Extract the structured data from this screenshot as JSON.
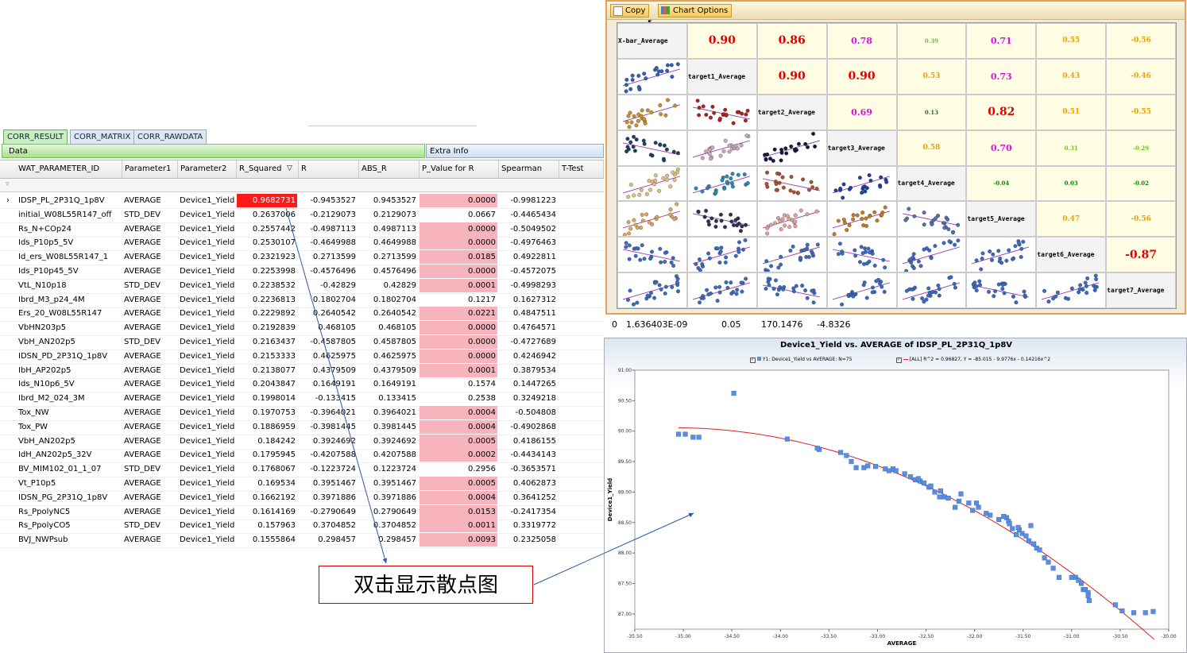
{
  "tabs": [
    "CORR_RESULT",
    "CORR_MATRIX",
    "CORR_RAWDATA"
  ],
  "data_bar": "Data",
  "extra_bar": "Extra Info",
  "columns": [
    "WAT_PARAMETER_ID",
    "Parameter1",
    "Parameter2",
    "R_Squared",
    "R",
    "ABS_R",
    "P_Value for R",
    "Spearman",
    "T-Test"
  ],
  "rows": [
    [
      "IDSP_PL_2P31Q_1p8V",
      "AVERAGE",
      "Device1_Yield",
      "0.9682731",
      "-0.9453527",
      "0.9453527",
      "0.0000",
      "-0.9981223"
    ],
    [
      "initial_W08L55R147_off",
      "STD_DEV",
      "Device1_Yield",
      "0.2637006",
      "-0.2129073",
      "0.2129073",
      "0.0667",
      "-0.4465434"
    ],
    [
      "Rs_N+COp24",
      "AVERAGE",
      "Device1_Yield",
      "0.2557442",
      "-0.4987113",
      "0.4987113",
      "0.0000",
      "-0.5049502"
    ],
    [
      "Ids_P10p5_5V",
      "AVERAGE",
      "Device1_Yield",
      "0.2530107",
      "-0.4649988",
      "0.4649988",
      "0.0000",
      "-0.4976463"
    ],
    [
      "Id_ers_W08L55R147_1",
      "AVERAGE",
      "Device1_Yield",
      "0.2321923",
      "0.2713599",
      "0.2713599",
      "0.0185",
      "0.4922811"
    ],
    [
      "Ids_P10p45_5V",
      "AVERAGE",
      "Device1_Yield",
      "0.2253998",
      "-0.4576496",
      "0.4576496",
      "0.0000",
      "-0.4572075"
    ],
    [
      "VtL_N10p18",
      "STD_DEV",
      "Device1_Yield",
      "0.2238532",
      "-0.42829",
      "0.42829",
      "0.0001",
      "-0.4998293"
    ],
    [
      "Ibrd_M3_p24_4M",
      "AVERAGE",
      "Device1_Yield",
      "0.2236813",
      "0.1802704",
      "0.1802704",
      "0.1217",
      "0.1627312"
    ],
    [
      "Ers_20_W08L55R147",
      "AVERAGE",
      "Device1_Yield",
      "0.2229892",
      "0.2640542",
      "0.2640542",
      "0.0221",
      "0.4847511"
    ],
    [
      "VbHN203p5",
      "AVERAGE",
      "Device1_Yield",
      "0.2192839",
      "0.468105",
      "0.468105",
      "0.0000",
      "0.4764571"
    ],
    [
      "VbH_AN202p5",
      "STD_DEV",
      "Device1_Yield",
      "0.2163437",
      "-0.4587805",
      "0.4587805",
      "0.0000",
      "-0.4727689"
    ],
    [
      "IDSN_PD_2P31Q_1p8V",
      "AVERAGE",
      "Device1_Yield",
      "0.2153333",
      "0.4625975",
      "0.4625975",
      "0.0000",
      "0.4246942"
    ],
    [
      "IbH_AP202p5",
      "AVERAGE",
      "Device1_Yield",
      "0.2138077",
      "0.4379509",
      "0.4379509",
      "0.0001",
      "0.3879534"
    ],
    [
      "Ids_N10p6_5V",
      "AVERAGE",
      "Device1_Yield",
      "0.2043847",
      "0.1649191",
      "0.1649191",
      "0.1574",
      "0.1447265"
    ],
    [
      "Ibrd_M2_024_3M",
      "AVERAGE",
      "Device1_Yield",
      "0.1998014",
      "-0.133415",
      "0.133415",
      "0.2538",
      "0.3249218"
    ],
    [
      "Tox_NW",
      "AVERAGE",
      "Device1_Yield",
      "0.1970753",
      "-0.3964021",
      "0.3964021",
      "0.0004",
      "-0.504808"
    ],
    [
      "Tox_PW",
      "AVERAGE",
      "Device1_Yield",
      "0.1886959",
      "-0.3981445",
      "0.3981445",
      "0.0004",
      "-0.4902868"
    ],
    [
      "VbH_AN202p5",
      "AVERAGE",
      "Device1_Yield",
      "0.184242",
      "0.3924692",
      "0.3924692",
      "0.0005",
      "0.4186155"
    ],
    [
      "IdH_AN202p5_32V",
      "AVERAGE",
      "Device1_Yield",
      "0.1795945",
      "-0.4207588",
      "0.4207588",
      "0.0002",
      "-0.4434143"
    ],
    [
      "BV_MIM102_01_1_07",
      "STD_DEV",
      "Device1_Yield",
      "0.1768067",
      "-0.1223724",
      "0.1223724",
      "0.2956",
      "-0.3653571"
    ],
    [
      "Vt_P10p5",
      "AVERAGE",
      "Device1_Yield",
      "0.169534",
      "0.3951467",
      "0.3951467",
      "0.0005",
      "0.4062873"
    ],
    [
      "IDSN_PG_2P31Q_1p8V",
      "AVERAGE",
      "Device1_Yield",
      "0.1662192",
      "0.3971886",
      "0.3971886",
      "0.0004",
      "0.3641252"
    ],
    [
      "Rs_PpolyNC5",
      "AVERAGE",
      "Device1_Yield",
      "0.1614169",
      "-0.2790649",
      "0.2790649",
      "0.0153",
      "-0.2417354"
    ],
    [
      "Rs_PpolyCO5",
      "STD_DEV",
      "Device1_Yield",
      "0.157963",
      "0.3704852",
      "0.3704852",
      "0.0011",
      "0.3319772"
    ],
    [
      "BVJ_NWPsub",
      "AVERAGE",
      "Device1_Yield",
      "0.1555864",
      "0.298457",
      "0.298457",
      "0.0093",
      "0.2325058"
    ]
  ],
  "colors": {
    "significant": "#f7b4bd",
    "best": "#ff1a1a"
  },
  "matrix": {
    "toolbar": [
      "Copy",
      "Chart Options"
    ],
    "labels": [
      "X-bar_Average",
      "target1_Average",
      "target2_Average",
      "target3_Average",
      "target4_Average",
      "target5_Average",
      "target6_Average",
      "target7_Average"
    ],
    "values": [
      [
        "",
        "0.90",
        "0.86",
        "0.78",
        "0.39",
        "0.71",
        "0.55",
        "-0.56"
      ],
      [
        "",
        "",
        "0.90",
        "0.90",
        "0.53",
        "0.73",
        "0.43",
        "-0.46"
      ],
      [
        "",
        "",
        "",
        "0.69",
        "0.13",
        "0.82",
        "0.51",
        "-0.55"
      ],
      [
        "",
        "",
        "",
        "",
        "0.58",
        "0.70",
        "0.31",
        "-0.29"
      ],
      [
        "",
        "",
        "",
        "",
        "",
        "-0.04",
        "0.03",
        "-0.02"
      ],
      [
        "",
        "",
        "",
        "",
        "",
        "",
        "0.47",
        "-0.56"
      ],
      [
        "",
        "",
        "",
        "",
        "",
        "",
        "",
        "-0.87"
      ],
      [
        "",
        "",
        "",
        "",
        "",
        "",
        "",
        ""
      ]
    ],
    "value_colors": [
      [
        "",
        "#e00000",
        "#e00000",
        "#e010e0",
        "#70c020",
        "#e010e0",
        "#f0a000",
        "#f0a000"
      ],
      [
        "",
        "",
        "#e00000",
        "#e00000",
        "#f0a000",
        "#e010e0",
        "#f0a000",
        "#f0a000"
      ],
      [
        "",
        "",
        "",
        "#e010e0",
        "#108010",
        "#e00000",
        "#f0a000",
        "#f0a000"
      ],
      [
        "",
        "",
        "",
        "",
        "#f0a000",
        "#e010e0",
        "#70c020",
        "#70c020"
      ],
      [
        "",
        "",
        "",
        "",
        "",
        "#108010",
        "#108010",
        "#108010"
      ],
      [
        "",
        "",
        "",
        "",
        "",
        "",
        "#f0a000",
        "#f0a000"
      ],
      [
        "",
        "",
        "",
        "",
        "",
        "",
        "",
        "#e00000"
      ],
      [
        "",
        "",
        "",
        "",
        "",
        "",
        "",
        ""
      ]
    ],
    "dot_colors": [
      [
        "#3060b0"
      ],
      [
        "#c8902a",
        "#b02020"
      ],
      [
        "#1e3f66",
        "#c8a8b8",
        "#101a40"
      ],
      [
        "#e0c080",
        "#2a8ab0",
        "#a85030",
        "#2040a0"
      ],
      [
        "#d8a860",
        "#303050",
        "#e0a0a0",
        "#c87820",
        "#5070b0"
      ],
      [
        "#3a6ac0",
        "#3a6ac0",
        "#3a6ac0",
        "#3a6ac0",
        "#3a6ac0",
        "#3a6ac0"
      ],
      [
        "#3a6ac0",
        "#3a6ac0",
        "#3a6ac0",
        "#3a6ac0",
        "#3a6ac0",
        "#3a6ac0",
        "#3a6ac0"
      ]
    ]
  },
  "stray_row": [
    "0",
    "1.636403E-09",
    "0.05",
    "170.1476",
    "-4.8326"
  ],
  "scatter": {
    "title": "Device1_Yield vs. AVERAGE of IDSP_PL_2P31Q_1p8V",
    "legend1": "Y1: Device1_Yield vs AVERAGE: N=75",
    "legend2": "[ALL] R^2 = 0.96827, Y = -85.015 - 9.9776x - 0.14216x^2"
  },
  "callout": "双击显示散点图",
  "chart_data": {
    "type": "scatter",
    "title": "Device1_Yield vs. AVERAGE of IDSP_PL_2P31Q_1p8V",
    "xlabel": "AVERAGE",
    "ylabel": "Device1_Yield",
    "xlim": [
      -35.5,
      -30.0
    ],
    "ylim": [
      86.75,
      91.0
    ],
    "xticks": [
      "-35.50",
      "-35.00",
      "-34.50",
      "-34.00",
      "-33.50",
      "-33.00",
      "-32.50",
      "-32.00",
      "-31.50",
      "-31.00",
      "-30.50",
      "-30.00"
    ],
    "yticks": [
      "87.00",
      "87.50",
      "88.00",
      "88.50",
      "89.00",
      "89.50",
      "90.00",
      "90.50",
      "91.00"
    ],
    "fit": {
      "a": -85.015,
      "b": -9.9776,
      "c": -0.14216,
      "x_range": [
        -35.05,
        -30.15
      ],
      "color": "#e02020"
    },
    "point_color": "#5b8ee0",
    "series": [
      {
        "name": "Y1: Device1_Yield vs AVERAGE: N=75",
        "points": [
          [
            -35.05,
            89.95
          ],
          [
            -34.98,
            89.95
          ],
          [
            -34.9,
            89.9
          ],
          [
            -34.84,
            89.9
          ],
          [
            -34.48,
            90.62
          ],
          [
            -33.93,
            89.87
          ],
          [
            -33.6,
            89.7
          ],
          [
            -33.38,
            89.65
          ],
          [
            -33.32,
            89.6
          ],
          [
            -33.27,
            89.5
          ],
          [
            -33.22,
            89.4
          ],
          [
            -33.14,
            89.4
          ],
          [
            -33.02,
            89.42
          ],
          [
            -32.92,
            89.38
          ],
          [
            -32.84,
            89.38
          ],
          [
            -32.81,
            89.35
          ],
          [
            -32.72,
            89.3
          ],
          [
            -32.66,
            89.25
          ],
          [
            -32.61,
            89.2
          ],
          [
            -32.56,
            89.18
          ],
          [
            -32.52,
            89.15
          ],
          [
            -32.47,
            89.08
          ],
          [
            -32.45,
            89.1
          ],
          [
            -32.41,
            89.0
          ],
          [
            -32.36,
            88.92
          ],
          [
            -32.31,
            88.92
          ],
          [
            -32.27,
            88.9
          ],
          [
            -32.2,
            88.75
          ],
          [
            -32.16,
            88.85
          ],
          [
            -32.06,
            88.82
          ],
          [
            -32.02,
            88.7
          ],
          [
            -31.96,
            88.75
          ],
          [
            -31.88,
            88.65
          ],
          [
            -31.84,
            88.62
          ],
          [
            -31.75,
            88.55
          ],
          [
            -31.67,
            88.58
          ],
          [
            -31.65,
            88.52
          ],
          [
            -31.64,
            88.48
          ],
          [
            -31.61,
            88.4
          ],
          [
            -31.57,
            88.3
          ],
          [
            -31.54,
            88.38
          ],
          [
            -31.51,
            88.32
          ],
          [
            -31.47,
            88.28
          ],
          [
            -31.44,
            88.2
          ],
          [
            -31.42,
            88.45
          ],
          [
            -31.39,
            88.15
          ],
          [
            -31.36,
            88.08
          ],
          [
            -31.33,
            88.05
          ],
          [
            -31.28,
            87.92
          ],
          [
            -31.24,
            87.85
          ],
          [
            -31.19,
            87.75
          ],
          [
            -31.13,
            87.6
          ],
          [
            -31.0,
            87.6
          ],
          [
            -30.96,
            87.6
          ],
          [
            -30.93,
            87.55
          ],
          [
            -30.9,
            87.5
          ],
          [
            -30.88,
            87.4
          ],
          [
            -30.86,
            87.4
          ],
          [
            -30.83,
            87.35
          ],
          [
            -30.83,
            87.3
          ],
          [
            -30.82,
            87.22
          ],
          [
            -30.55,
            87.15
          ],
          [
            -30.48,
            87.05
          ],
          [
            -30.36,
            87.02
          ],
          [
            -30.24,
            87.02
          ],
          [
            -30.16,
            87.04
          ],
          [
            -31.98,
            88.82
          ],
          [
            -32.14,
            88.97
          ],
          [
            -32.58,
            89.22
          ],
          [
            -31.7,
            88.6
          ],
          [
            -32.88,
            89.35
          ],
          [
            -33.1,
            89.43
          ],
          [
            -32.35,
            89.02
          ],
          [
            -31.55,
            88.42
          ],
          [
            -33.62,
            89.72
          ]
        ]
      }
    ]
  }
}
